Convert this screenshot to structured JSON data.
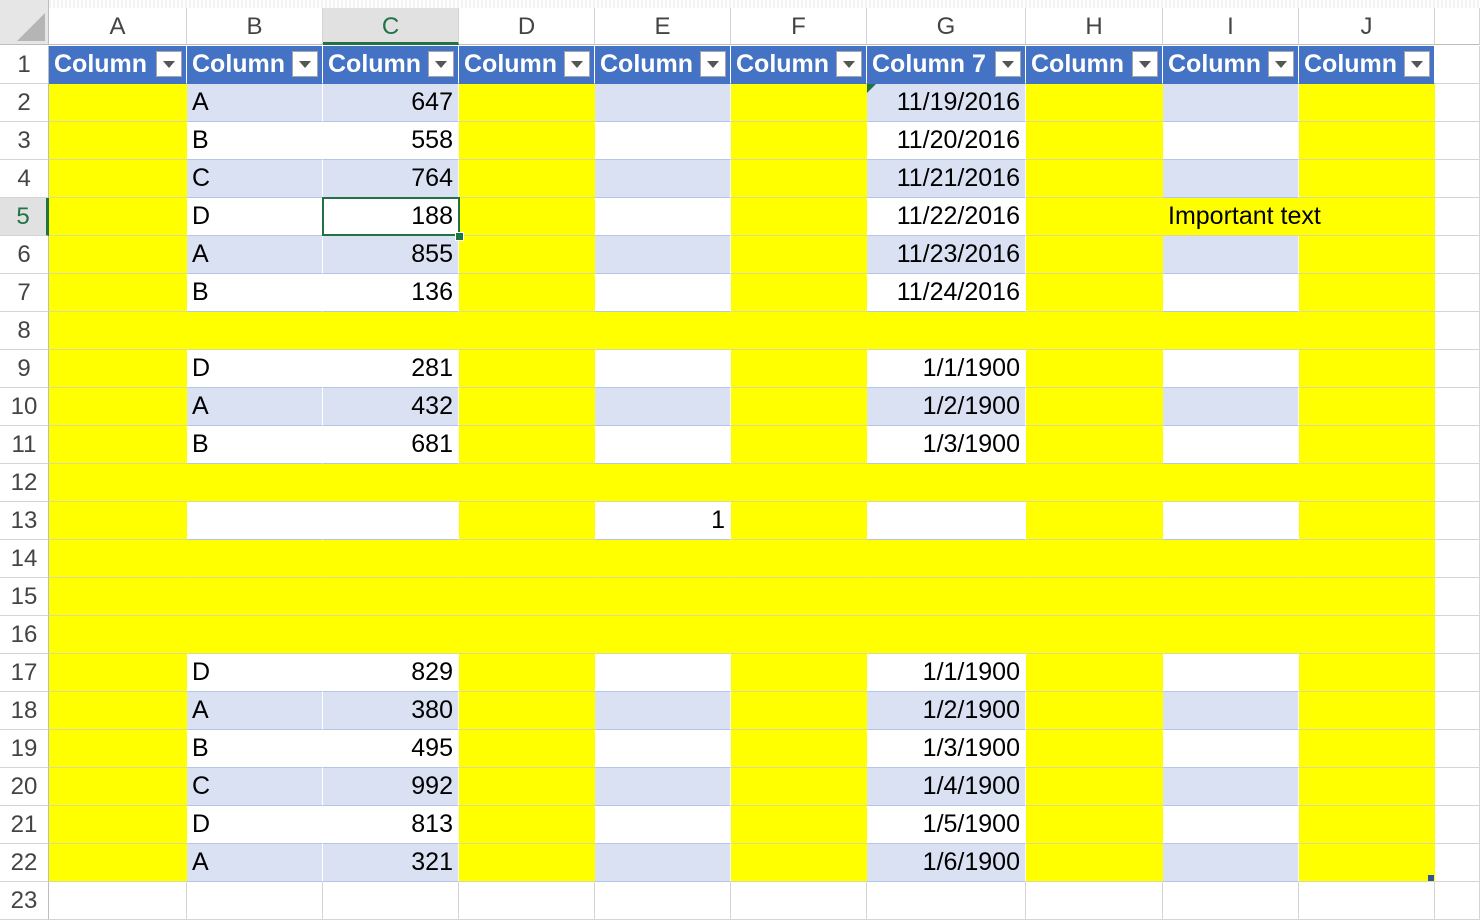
{
  "columns": [
    "A",
    "B",
    "C",
    "D",
    "E",
    "F",
    "G",
    "H",
    "I",
    "J"
  ],
  "active_column": "C",
  "active_row": 5,
  "header_row": 1,
  "header_labels": [
    "Column",
    "Column",
    "Column",
    "Column",
    "Column",
    "Column",
    "Column 7",
    "Column",
    "Column",
    "Column"
  ],
  "rows": [
    {
      "row": 2,
      "band": true,
      "B": "A",
      "C": "647",
      "G": "11/19/2016"
    },
    {
      "row": 3,
      "band": false,
      "B": "B",
      "C": "558",
      "G": "11/20/2016"
    },
    {
      "row": 4,
      "band": true,
      "B": "C",
      "C": "764",
      "G": "11/21/2016"
    },
    {
      "row": 5,
      "band": false,
      "B": "D",
      "C": "188",
      "G": "11/22/2016",
      "I": "Important text",
      "I_yellow": true
    },
    {
      "row": 6,
      "band": true,
      "B": "A",
      "C": "855",
      "G": "11/23/2016"
    },
    {
      "row": 7,
      "band": false,
      "B": "B",
      "C": "136",
      "G": "11/24/2016"
    },
    {
      "row": 8,
      "all_yellow": true
    },
    {
      "row": 9,
      "band": false,
      "B": "D",
      "C": "281",
      "G": "1/1/1900"
    },
    {
      "row": 10,
      "band": true,
      "B": "A",
      "C": "432",
      "G": "1/2/1900"
    },
    {
      "row": 11,
      "band": false,
      "B": "B",
      "C": "681",
      "G": "1/3/1900"
    },
    {
      "row": 12,
      "all_yellow": true
    },
    {
      "row": 13,
      "band": false,
      "E": "1"
    },
    {
      "row": 14,
      "all_yellow": true
    },
    {
      "row": 15,
      "all_yellow": true
    },
    {
      "row": 16,
      "all_yellow": true
    },
    {
      "row": 17,
      "band": false,
      "B": "D",
      "C": "829",
      "G": "1/1/1900"
    },
    {
      "row": 18,
      "band": true,
      "B": "A",
      "C": "380",
      "G": "1/2/1900"
    },
    {
      "row": 19,
      "band": false,
      "B": "B",
      "C": "495",
      "G": "1/3/1900"
    },
    {
      "row": 20,
      "band": true,
      "B": "C",
      "C": "992",
      "G": "1/4/1900"
    },
    {
      "row": 21,
      "band": false,
      "B": "D",
      "C": "813",
      "G": "1/5/1900"
    },
    {
      "row": 22,
      "band": true,
      "B": "A",
      "C": "321",
      "G": "1/6/1900"
    },
    {
      "row": 23,
      "outside_table": true
    }
  ],
  "yellow_columns": [
    "A",
    "D",
    "F",
    "H",
    "J"
  ],
  "number_columns": [
    "C",
    "E",
    "G"
  ],
  "colors": {
    "header_fill": "#4472c4",
    "band_fill": "#d9e1f2",
    "highlight_fill": "#ffff00",
    "selection": "#217346"
  }
}
